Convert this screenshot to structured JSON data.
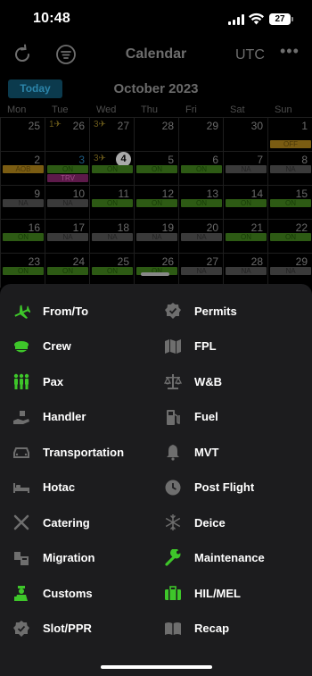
{
  "status": {
    "time": "10:48",
    "battery": "27"
  },
  "nav": {
    "title": "Calendar",
    "tz": "UTC"
  },
  "calendar": {
    "today_label": "Today",
    "month": "October 2023",
    "weekdays": [
      "Mon",
      "Tue",
      "Wed",
      "Thu",
      "Fri",
      "Sat",
      "Sun"
    ],
    "weeks": [
      [
        {
          "day": "25"
        },
        {
          "day": "26",
          "tag": "1✈"
        },
        {
          "day": "27",
          "tag": "3✈"
        },
        {
          "day": "28"
        },
        {
          "day": "29"
        },
        {
          "day": "30"
        },
        {
          "day": "1",
          "chips": [
            {
              "text": "OFF",
              "style": "gold",
              "row": 1
            }
          ]
        }
      ],
      [
        {
          "day": "2",
          "chips": [
            {
              "text": "AOB",
              "style": "gold",
              "row": 0
            }
          ]
        },
        {
          "day": "3",
          "active": true,
          "chips": [
            {
              "text": "ON",
              "style": "on",
              "row": 0
            },
            {
              "text": "TRV",
              "style": "trv",
              "row": 1
            }
          ]
        },
        {
          "day": "4",
          "today": true,
          "tag": "3✈",
          "chips": [
            {
              "text": "ON",
              "style": "on",
              "row": 0
            }
          ]
        },
        {
          "day": "5",
          "chips": [
            {
              "text": "ON",
              "style": "on",
              "row": 0
            }
          ]
        },
        {
          "day": "6",
          "chips": [
            {
              "text": "ON",
              "style": "on",
              "row": 0
            }
          ]
        },
        {
          "day": "7",
          "chips": [
            {
              "text": "NA",
              "style": "na",
              "row": 0
            }
          ]
        },
        {
          "day": "8",
          "chips": [
            {
              "text": "NA",
              "style": "na",
              "row": 0
            }
          ]
        }
      ],
      [
        {
          "day": "9",
          "chips": [
            {
              "text": "NA",
              "style": "na",
              "row": 0
            }
          ]
        },
        {
          "day": "10",
          "chips": [
            {
              "text": "NA",
              "style": "na",
              "row": 0
            }
          ]
        },
        {
          "day": "11",
          "chips": [
            {
              "text": "ON",
              "style": "on",
              "row": 0
            }
          ]
        },
        {
          "day": "12",
          "chips": [
            {
              "text": "ON",
              "style": "on",
              "row": 0
            }
          ]
        },
        {
          "day": "13",
          "chips": [
            {
              "text": "ON",
              "style": "on",
              "row": 0
            }
          ]
        },
        {
          "day": "14",
          "chips": [
            {
              "text": "ON",
              "style": "on",
              "row": 0
            }
          ]
        },
        {
          "day": "15",
          "chips": [
            {
              "text": "ON",
              "style": "on",
              "row": 0
            }
          ]
        }
      ],
      [
        {
          "day": "16",
          "chips": [
            {
              "text": "ON",
              "style": "on",
              "row": 0
            }
          ]
        },
        {
          "day": "17",
          "chips": [
            {
              "text": "NA",
              "style": "na",
              "row": 0
            }
          ]
        },
        {
          "day": "18",
          "chips": [
            {
              "text": "NA",
              "style": "na",
              "row": 0
            }
          ]
        },
        {
          "day": "19",
          "chips": [
            {
              "text": "NA",
              "style": "na",
              "row": 0
            }
          ]
        },
        {
          "day": "20",
          "chips": [
            {
              "text": "NA",
              "style": "na",
              "row": 0
            }
          ]
        },
        {
          "day": "21",
          "chips": [
            {
              "text": "ON",
              "style": "on",
              "row": 0
            }
          ]
        },
        {
          "day": "22",
          "chips": [
            {
              "text": "ON",
              "style": "on",
              "row": 0
            }
          ]
        }
      ],
      [
        {
          "day": "23",
          "chips": [
            {
              "text": "ON",
              "style": "on",
              "row": 0
            }
          ]
        },
        {
          "day": "24",
          "chips": [
            {
              "text": "ON",
              "style": "on",
              "row": 0
            }
          ]
        },
        {
          "day": "25",
          "chips": [
            {
              "text": "ON",
              "style": "on",
              "row": 0
            }
          ]
        },
        {
          "day": "26",
          "chips": [
            {
              "text": "ON",
              "style": "on",
              "row": 0
            }
          ]
        },
        {
          "day": "27",
          "chips": [
            {
              "text": "NA",
              "style": "na",
              "row": 0
            }
          ]
        },
        {
          "day": "28",
          "chips": [
            {
              "text": "NA",
              "style": "na",
              "row": 0
            }
          ]
        },
        {
          "day": "29",
          "chips": [
            {
              "text": "NA",
              "style": "na",
              "row": 0
            }
          ]
        }
      ]
    ]
  },
  "menu": {
    "left": [
      {
        "label": "From/To",
        "icon": "airplane-icon",
        "highlight": true
      },
      {
        "label": "Crew",
        "icon": "pilot-cap-icon",
        "highlight": true
      },
      {
        "label": "Pax",
        "icon": "people-icon",
        "highlight": true
      },
      {
        "label": "Handler",
        "icon": "hand-icon",
        "highlight": false
      },
      {
        "label": "Transportation",
        "icon": "car-icon",
        "highlight": false
      },
      {
        "label": "Hotac",
        "icon": "bed-icon",
        "highlight": false
      },
      {
        "label": "Catering",
        "icon": "utensils-icon",
        "highlight": false
      },
      {
        "label": "Migration",
        "icon": "passport-icon",
        "highlight": false
      },
      {
        "label": "Customs",
        "icon": "customs-officer-icon",
        "highlight": true
      },
      {
        "label": "Slot/PPR",
        "icon": "badge-check-icon",
        "highlight": false
      }
    ],
    "right": [
      {
        "label": "Permits",
        "icon": "badge-check-icon",
        "highlight": false
      },
      {
        "label": "FPL",
        "icon": "map-icon",
        "highlight": false
      },
      {
        "label": "W&B",
        "icon": "scale-icon",
        "highlight": false
      },
      {
        "label": "Fuel",
        "icon": "gas-pump-icon",
        "highlight": false
      },
      {
        "label": "MVT",
        "icon": "bell-icon",
        "highlight": false
      },
      {
        "label": "Post Flight",
        "icon": "clock-icon",
        "highlight": false
      },
      {
        "label": "Deice",
        "icon": "snowflake-icon",
        "highlight": false
      },
      {
        "label": "Maintenance",
        "icon": "wrench-icon",
        "highlight": true
      },
      {
        "label": "HIL/MEL",
        "icon": "briefcase-icon",
        "highlight": true
      },
      {
        "label": "Recap",
        "icon": "book-icon",
        "highlight": false
      }
    ]
  },
  "colors": {
    "accent_green": "#3ec62a",
    "icon_gray": "#6e6e6e",
    "sheet_bg": "#1c1c1e"
  }
}
